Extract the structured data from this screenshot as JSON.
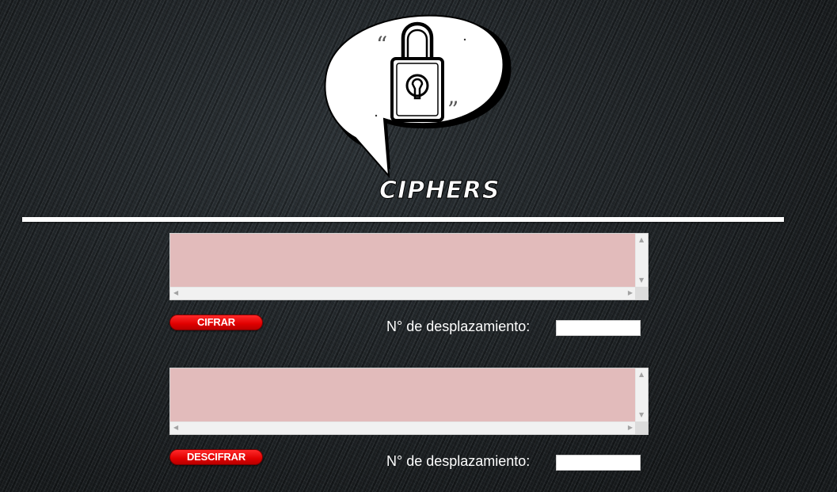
{
  "logo": {
    "text": "CIPHERS",
    "icon": "padlock-speech-bubble"
  },
  "encrypt": {
    "textarea_value": "",
    "button_label": "CIFRAR",
    "shift_label": "N° de desplazamiento:",
    "shift_value": ""
  },
  "decrypt": {
    "textarea_value": "",
    "button_label": "DESCIFRAR",
    "shift_label": "N° de desplazamiento:",
    "shift_value": ""
  },
  "colors": {
    "textarea_bg": "#e2bbbb",
    "button_red": "#e00000",
    "divider": "#ffffff"
  }
}
